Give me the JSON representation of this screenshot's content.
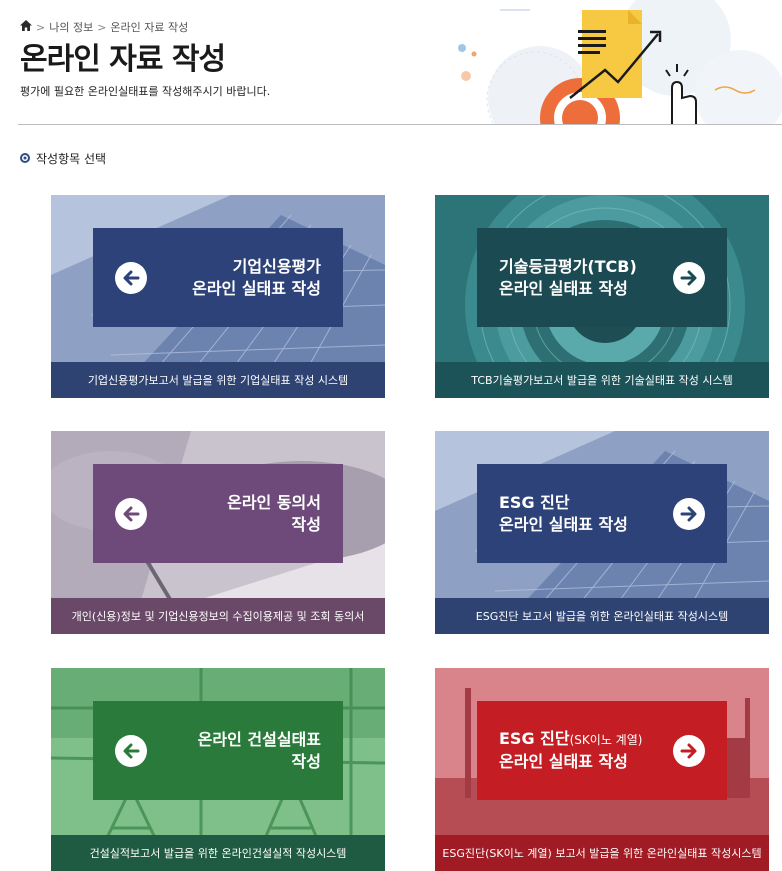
{
  "breadcrumb": {
    "home_icon": "home-icon",
    "level1": "나의 정보",
    "level2": "온라인 자료 작성"
  },
  "header": {
    "title": "온라인 자료 작성",
    "description": "평가에 필요한 온라인실태표를 작성해주시기 바랍니다."
  },
  "section": {
    "label": "작성항목 선택"
  },
  "cards": [
    {
      "title_line1": "기업신용평가",
      "title_line2": "온라인 실태표 작성",
      "caption": "기업신용평가보고서 발급을 위한 기업실태표 작성 시스템",
      "arrow": "arrow-left-icon",
      "color": "#2c4278"
    },
    {
      "title_line1": "기술등급평가(TCB)",
      "title_line2": "온라인 실태표 작성",
      "caption": "TCB기술평가보고서 발급을 위한 기술실태표 작성 시스템",
      "arrow": "arrow-right-icon",
      "color": "#1c5358"
    },
    {
      "title_line1": "온라인 동의서",
      "title_line2": "작성",
      "caption": "개인(신용)정보 및 기업신용정보의 수집이용제공 및 조회 동의서",
      "arrow": "arrow-left-icon",
      "color": "#6e4a7a"
    },
    {
      "title_line1": "ESG 진단",
      "title_line2": "온라인 실태표 작성",
      "caption": "ESG진단 보고서 발급을 위한 온라인실태표 작성시스템",
      "arrow": "arrow-right-icon",
      "color": "#2c4278"
    },
    {
      "title_line1": "온라인 건설실태표",
      "title_line2": "작성",
      "caption": "건설실적보고서 발급을 위한 온라인건설실적 작성시스템",
      "arrow": "arrow-left-icon",
      "color": "#2a7a3c"
    },
    {
      "title_line1_main": "ESG 진단",
      "title_line1_sub": "(SK이노 계열)",
      "title_line2": "온라인 실태표 작성",
      "caption": "ESG진단(SK이노 계열) 보고서 발급을 위한 온라인실태표 작성시스템",
      "arrow": "arrow-right-icon",
      "color": "#c41e24"
    }
  ]
}
